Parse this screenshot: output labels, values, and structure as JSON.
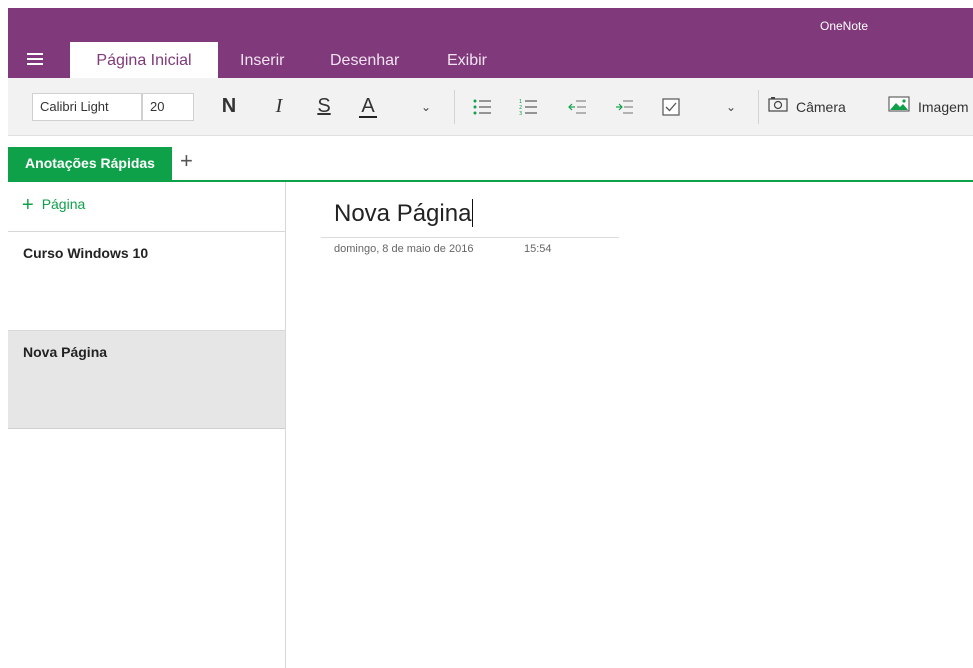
{
  "app": {
    "title": "OneNote"
  },
  "tabs": [
    {
      "label": "Página Inicial",
      "active": true
    },
    {
      "label": "Inserir"
    },
    {
      "label": "Desenhar"
    },
    {
      "label": "Exibir"
    }
  ],
  "ribbon": {
    "font_name": "Calibri Light",
    "font_size": "20",
    "bold": "N",
    "italic": "I",
    "underline": "S",
    "font_color": "A",
    "camera_label": "Câmera",
    "image_label": "Imagem"
  },
  "section": {
    "name": "Anotações Rápidas",
    "add": "+"
  },
  "pages": {
    "add_label": "Página",
    "items": [
      {
        "label": "Curso Windows 10"
      },
      {
        "label": "Nova Página",
        "selected": true
      }
    ]
  },
  "page": {
    "title": "Nova Página",
    "date": "domingo, 8 de maio de 2016",
    "time": "15:54"
  },
  "colors": {
    "brand": "#80397b",
    "section": "#0fa14a"
  }
}
